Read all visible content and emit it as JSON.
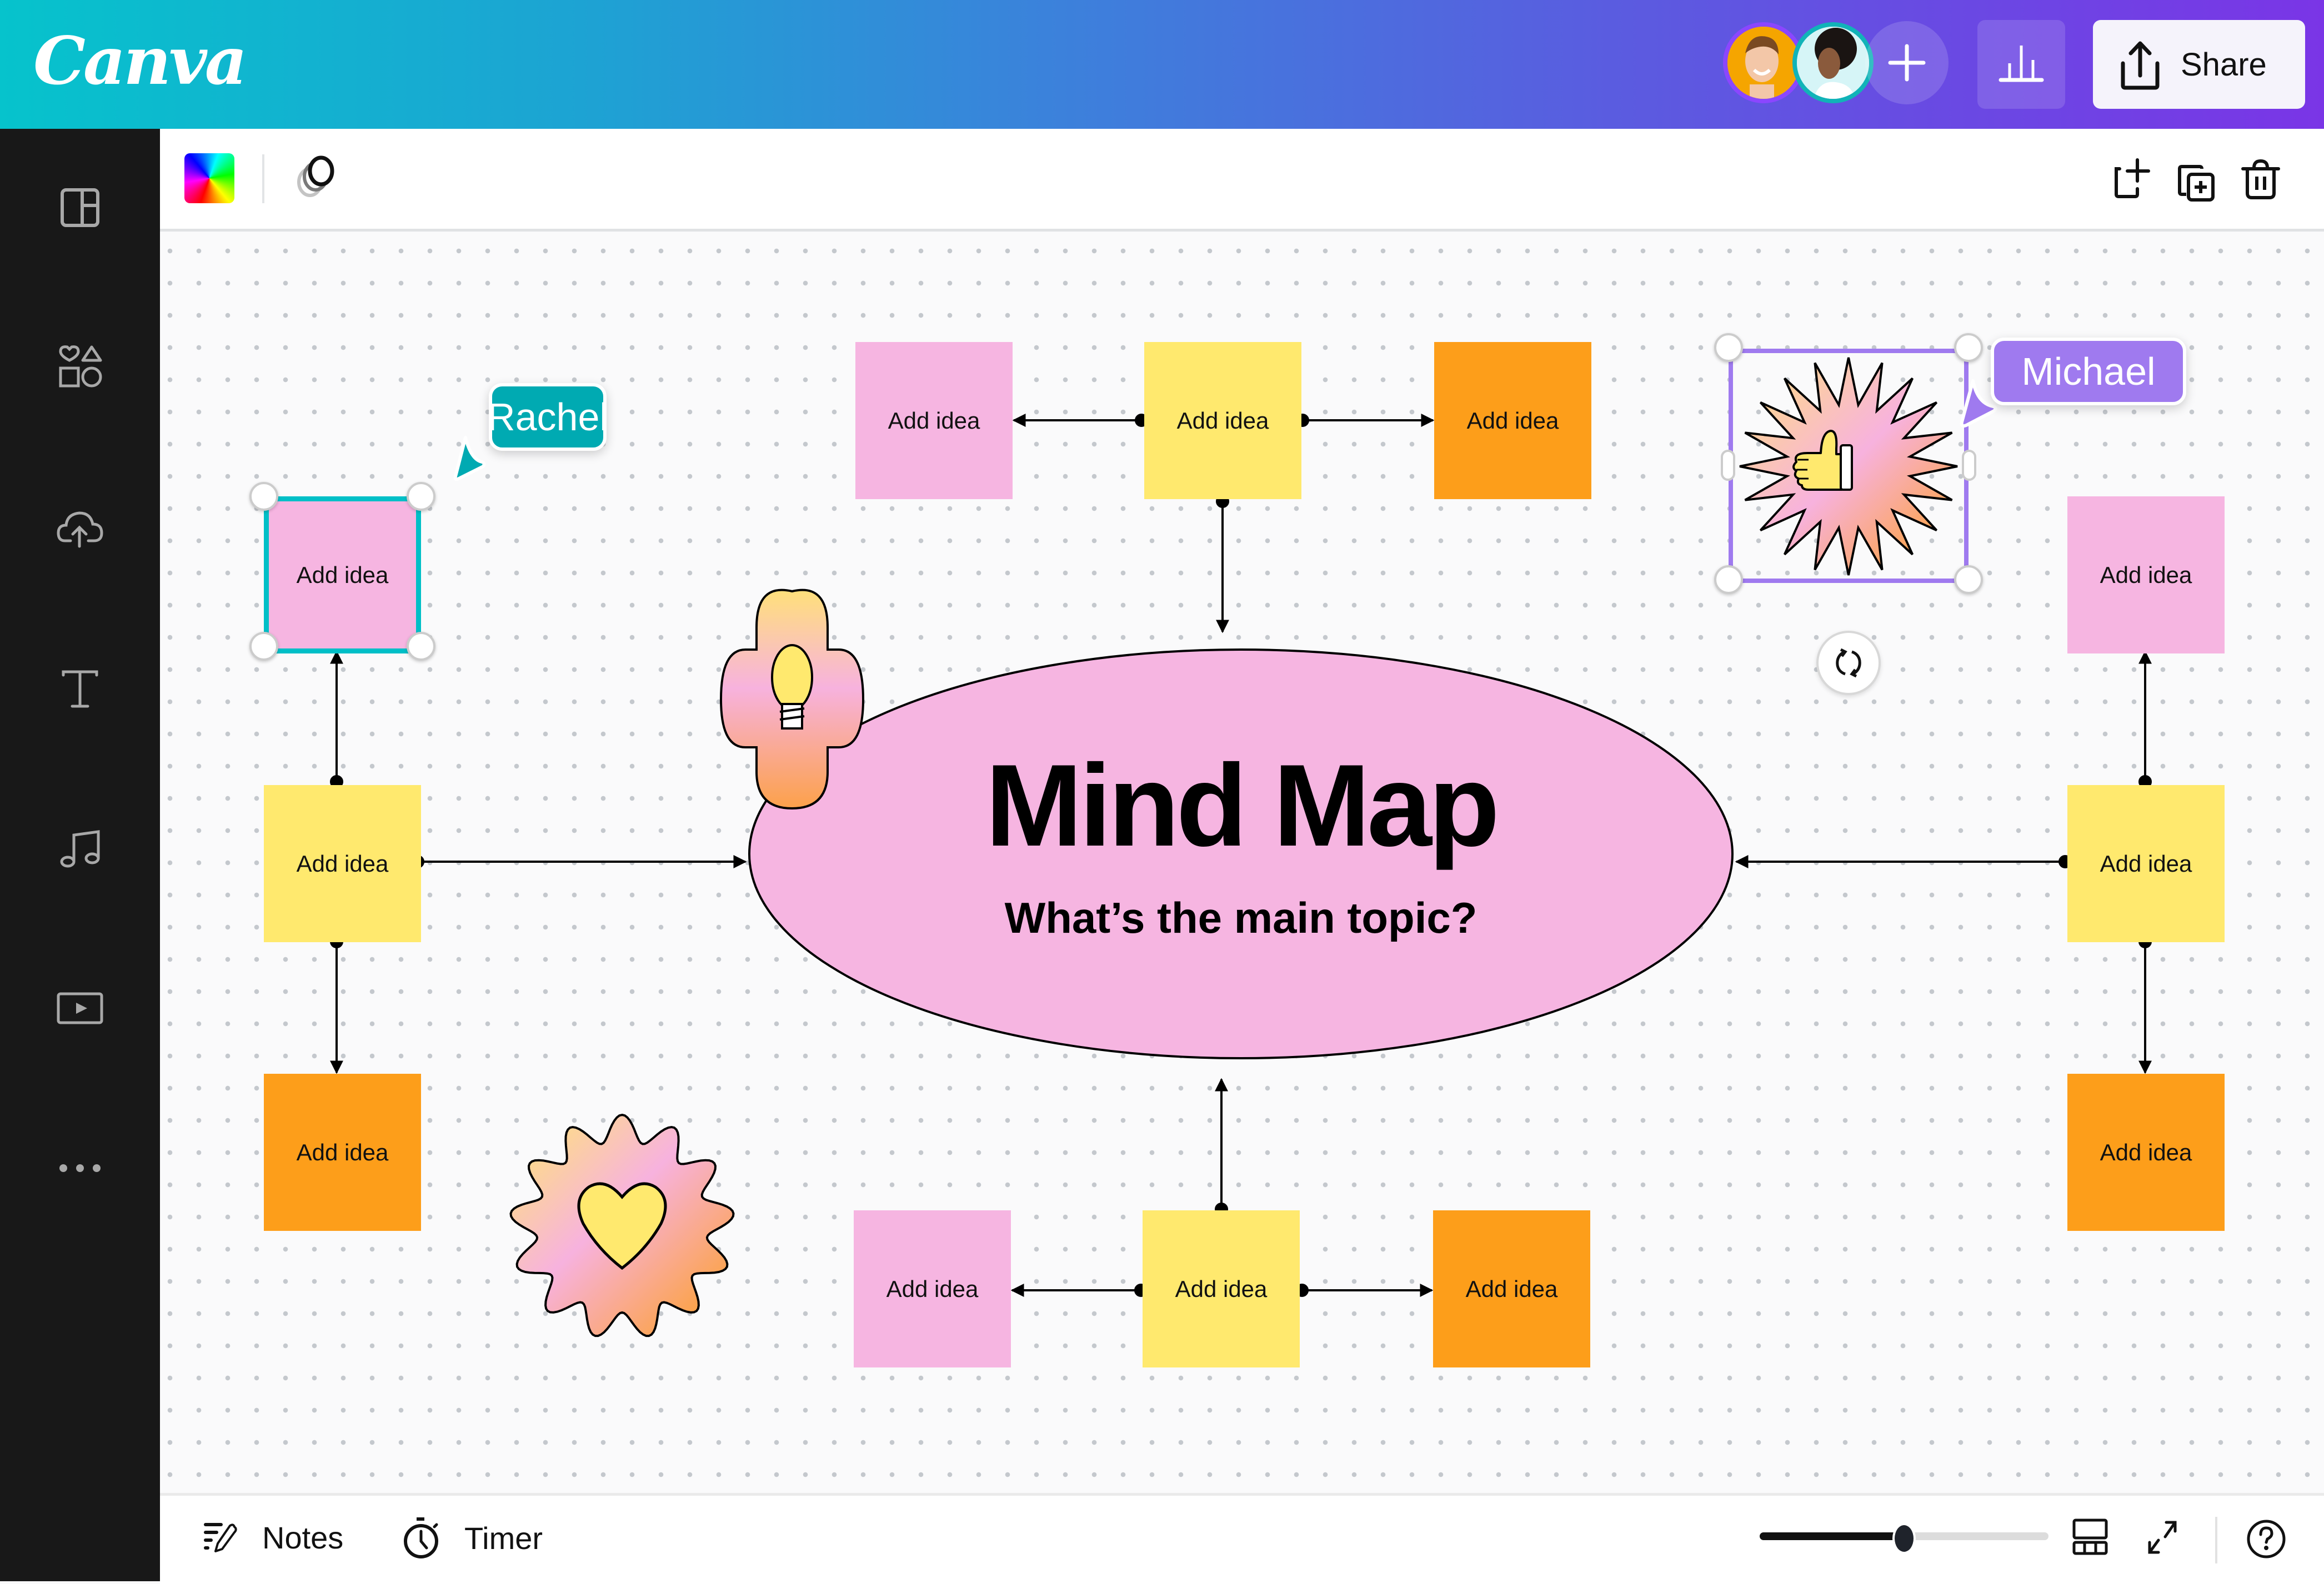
{
  "app": {
    "name": "Canva"
  },
  "header": {
    "logo_text": "Canva",
    "collaborators": [
      {
        "name": "collaborator-1",
        "ring_color": "#8b46ff"
      },
      {
        "name": "collaborator-2",
        "ring_color": "#11b3b8"
      }
    ],
    "add_collaborator_icon": "plus-icon",
    "analytics_icon": "bar-chart-icon",
    "share_label": "Share",
    "share_icon": "upload-icon"
  },
  "sidebar": {
    "items": [
      {
        "id": "design",
        "icon": "layout-icon"
      },
      {
        "id": "elements",
        "icon": "shapes-icon"
      },
      {
        "id": "uploads",
        "icon": "cloud-upload-icon"
      },
      {
        "id": "text",
        "icon": "text-icon"
      },
      {
        "id": "audio",
        "icon": "music-note-icon"
      },
      {
        "id": "videos",
        "icon": "video-play-icon"
      },
      {
        "id": "more",
        "icon": "more-dots-icon"
      }
    ]
  },
  "toolbar": {
    "left": [
      {
        "icon": "color-picker-icon"
      },
      {
        "icon": "transparency-icon"
      }
    ],
    "right": [
      {
        "icon": "add-page-icon"
      },
      {
        "icon": "duplicate-page-icon"
      },
      {
        "icon": "trash-icon"
      }
    ]
  },
  "canvas": {
    "colors": {
      "pink": "#f6b5e1",
      "yellow": "#ffe96e",
      "orange": "#fd9e1a",
      "rachel": "#00aab2",
      "michael": "#9f7aef"
    },
    "center": {
      "title": "Mind Map",
      "subtitle": "What’s the main topic?"
    },
    "stickies": [
      {
        "id": "top-left",
        "label": "Add idea",
        "color": "pink"
      },
      {
        "id": "top-center",
        "label": "Add idea",
        "color": "yellow"
      },
      {
        "id": "top-right",
        "label": "Add idea",
        "color": "orange"
      },
      {
        "id": "left-top",
        "label": "Add idea",
        "color": "pink",
        "selected_by": "Rachel"
      },
      {
        "id": "left-middle",
        "label": "Add idea",
        "color": "yellow"
      },
      {
        "id": "left-bottom",
        "label": "Add idea",
        "color": "orange"
      },
      {
        "id": "right-top",
        "label": "Add idea",
        "color": "pink"
      },
      {
        "id": "right-middle",
        "label": "Add idea",
        "color": "yellow"
      },
      {
        "id": "right-bottom",
        "label": "Add idea",
        "color": "orange"
      },
      {
        "id": "bottom-left",
        "label": "Add idea",
        "color": "pink"
      },
      {
        "id": "bottom-center",
        "label": "Add idea",
        "color": "yellow"
      },
      {
        "id": "bottom-right",
        "label": "Add idea",
        "color": "orange"
      }
    ],
    "cursors": [
      {
        "name": "Rachel",
        "color": "#00aab2"
      },
      {
        "name": "Michael",
        "color": "#9f7aef"
      }
    ],
    "stickers": [
      {
        "id": "lightbulb",
        "icon": "lightbulb-icon"
      },
      {
        "id": "thumbs-up",
        "icon": "thumbs-up-icon",
        "selected_by": "Michael"
      },
      {
        "id": "heart",
        "icon": "heart-icon"
      }
    ],
    "rotate_icon": "rotate-icon"
  },
  "bottombar": {
    "notes_label": "Notes",
    "timer_label": "Timer",
    "zoom_slider_value": 0.5,
    "grid_view_icon": "grid-view-icon",
    "fullscreen_icon": "fullscreen-icon",
    "help_icon": "help-icon"
  }
}
